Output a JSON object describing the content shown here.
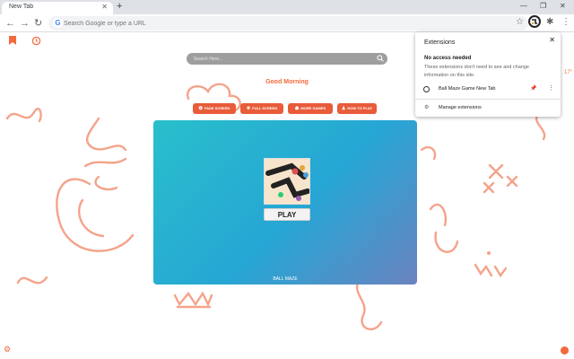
{
  "browser": {
    "tab": {
      "title": "New Tab",
      "close": "✕"
    },
    "new_tab": "+",
    "window_controls": {
      "minimize": "—",
      "restore": "❐",
      "close": "✕"
    },
    "nav": {
      "back": "←",
      "forward": "→",
      "reload": "↻"
    },
    "omnibox": {
      "placeholder": "Search Google or type a URL",
      "google_glyph": "G",
      "star": "☆"
    },
    "puzzle": "✱",
    "menu": "⋮"
  },
  "page": {
    "search": {
      "placeholder": "Search Here..."
    },
    "greeting": "Good Morning",
    "buttons": [
      {
        "label": "FADE SCREEN",
        "icon": "❂"
      },
      {
        "label": "FULL SCREEN",
        "icon": "✚"
      },
      {
        "label": "MORE GAMES",
        "icon": "☗"
      },
      {
        "label": "HOW TO PLAY",
        "icon": "♟"
      }
    ],
    "game": {
      "play_label": "PLAY",
      "name": "BALL MAZE"
    },
    "temperature": "17°"
  },
  "extensions_popup": {
    "title": "Extensions",
    "close": "✕",
    "section": "No access needed",
    "description": "These extensions don't need to see and change information on this site.",
    "item": {
      "name": "Ball Maze Game New Tab",
      "pin": "📌",
      "more": "⋮"
    },
    "manage": {
      "icon": "⚙",
      "label": "Manage extensions"
    }
  },
  "colors": {
    "accent": "#f26a3c",
    "button": "#e85c3a",
    "game_gradient_start": "#29bfcc",
    "game_gradient_end": "#6b83c0"
  }
}
